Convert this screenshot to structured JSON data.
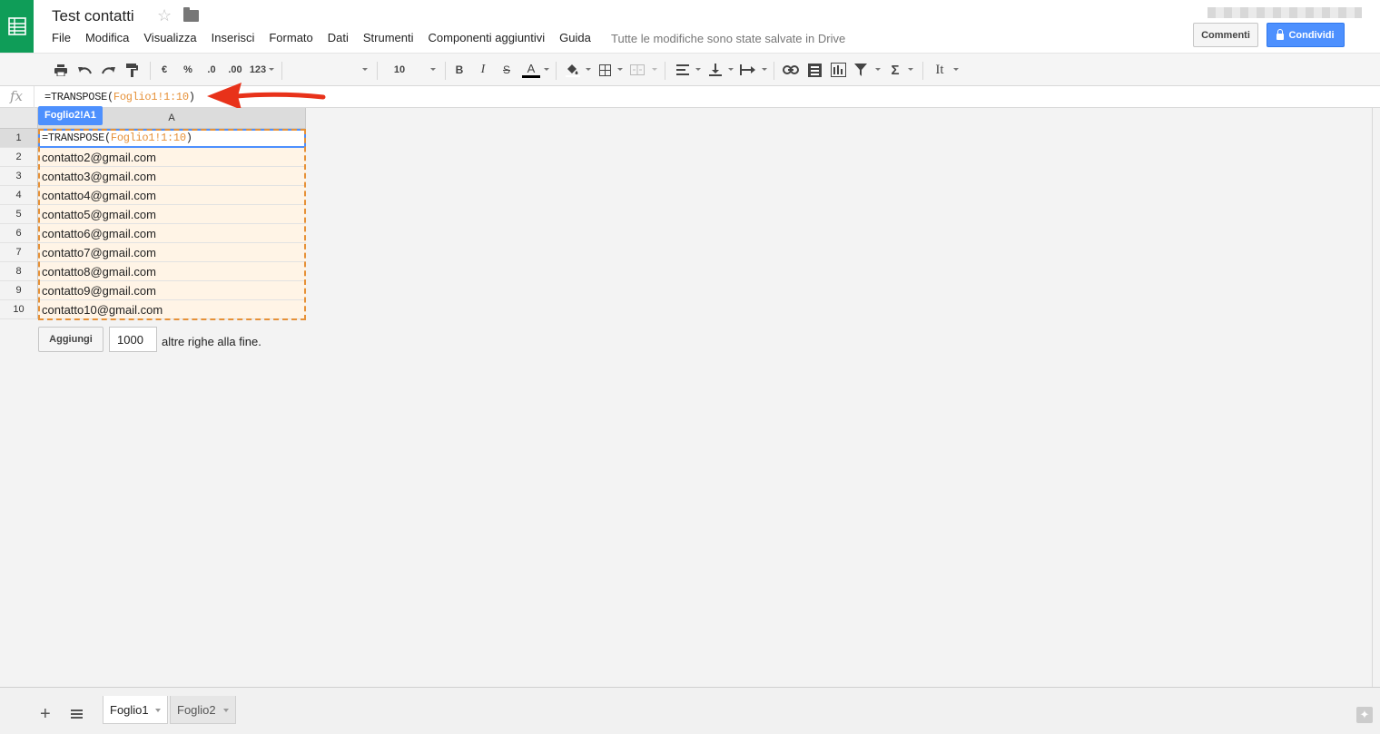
{
  "app": {
    "doc_title": "Test contatti",
    "menu": [
      "File",
      "Modifica",
      "Visualizza",
      "Inserisci",
      "Formato",
      "Dati",
      "Strumenti",
      "Componenti aggiuntivi",
      "Guida"
    ],
    "save_status": "Tutte le modifiche sono state salvate in Drive",
    "comments_label": "Commenti",
    "share_label": "Condividi",
    "brand_color": "#0f9d58",
    "accent_color": "#4d90fe"
  },
  "toolbar": {
    "currency_label": "€",
    "percent_label": "%",
    "decrease_decimals_label": ".0",
    "increase_decimals_label": ".00",
    "more_formats_label": "123",
    "font_name": "",
    "font_size": "10",
    "bold_label": "B",
    "italic_label": "I",
    "strike_label": "S",
    "text_color_label": "A",
    "sum_label": "Σ",
    "input_tools_label": "It"
  },
  "formula_bar": {
    "fx_label": "fx",
    "prefix": "=TRANSPOSE(",
    "range_ref": "Foglio1!1:10",
    "suffix": ")"
  },
  "grid": {
    "name_box": "Foglio2!A1",
    "column_header": "A",
    "rows": [
      {
        "num": "1",
        "value": ""
      },
      {
        "num": "2",
        "value": "contatto2@gmail.com"
      },
      {
        "num": "3",
        "value": "contatto3@gmail.com"
      },
      {
        "num": "4",
        "value": "contatto4@gmail.com"
      },
      {
        "num": "5",
        "value": "contatto5@gmail.com"
      },
      {
        "num": "6",
        "value": "contatto6@gmail.com"
      },
      {
        "num": "7",
        "value": "contatto7@gmail.com"
      },
      {
        "num": "8",
        "value": "contatto8@gmail.com"
      },
      {
        "num": "9",
        "value": "contatto9@gmail.com"
      },
      {
        "num": "10",
        "value": "contatto10@gmail.com"
      }
    ],
    "active_cell_formula": {
      "prefix": "=TRANSPOSE(",
      "range_ref": "Foglio1!1:10",
      "suffix": ")"
    },
    "range_highlight_color": "#e69138",
    "add_rows": {
      "button_label": "Aggiungi",
      "count": "1000",
      "suffix": "altre righe alla fine."
    }
  },
  "sheets": {
    "add_icon": "+",
    "tabs": [
      "Foglio1",
      "Foglio2"
    ],
    "active_tab": "Foglio1"
  }
}
